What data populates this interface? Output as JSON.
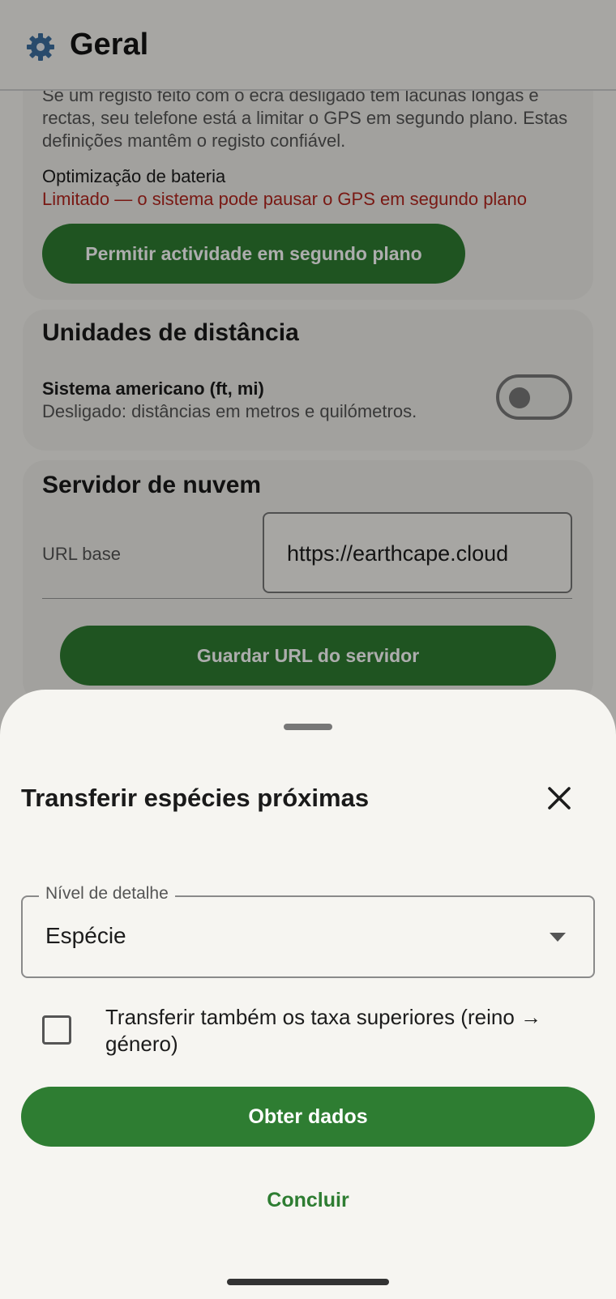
{
  "topbar": {
    "title": "Geral"
  },
  "battery": {
    "intro": "Se um registo feito com o ecrã desligado tem lacunas longas e rectas, seu telefone está a limitar o GPS em segundo plano. Estas definições mantêm o registo confiável.",
    "label": "Optimização de bateria",
    "status": "Limitado — o sistema pode pausar o GPS em segundo plano",
    "button": "Permitir actividade em segundo plano"
  },
  "units": {
    "heading": "Unidades de distância",
    "toggle_title": "Sistema americano (ft, mi)",
    "toggle_sub": "Desligado: distâncias em metros e quilómetros.",
    "toggle_on": false
  },
  "cloud": {
    "heading": "Servidor de nuvem",
    "url_label": "URL base",
    "url_value": "https://earthcape.cloud",
    "save_button": "Guardar URL do servidor"
  },
  "sheet": {
    "title": "Transferir espécies próximas",
    "detail_label": "Nível de detalhe",
    "detail_value": "Espécie",
    "checkbox_label": "Transferir também os taxa superiores (reino → género)",
    "checkbox_checked": false,
    "primary_button": "Obter dados",
    "secondary_button": "Concluir"
  },
  "colors": {
    "accent": "#2e7d32",
    "error": "#b3261e",
    "surface": "#f6f5f1"
  }
}
